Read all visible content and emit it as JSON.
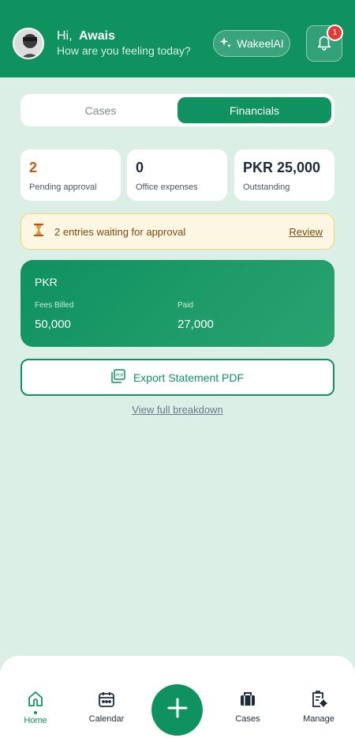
{
  "header": {
    "greeting": "Hi,",
    "user_name": "Awais",
    "subtitle": "How are you feeling today?",
    "ai_button_label": "WakeelAI",
    "notification_count": "1",
    "colors": {
      "brand": "#0f9160",
      "badge": "#e53935"
    }
  },
  "tabs": [
    {
      "label": "Cases",
      "active": false
    },
    {
      "label": "Financials",
      "active": true
    }
  ],
  "stats": [
    {
      "value": "2",
      "label": "Pending approval",
      "color": "#c05a10"
    },
    {
      "value": "0",
      "label": "Office expenses"
    },
    {
      "value": "PKR 25,000",
      "label": "Outstanding"
    }
  ],
  "approval": {
    "icon": "hourglass-icon",
    "text": "2 entries waiting for approval",
    "link": "Review"
  },
  "summary": {
    "currency": "PKR",
    "fees_billed_label": "Fees Billed",
    "fees_billed_value": "50,000",
    "paid_label": "Paid",
    "paid_value": "27,000"
  },
  "export_button": {
    "label": "Export Statement PDF",
    "icon": "pdf-icon"
  },
  "breakdown_link": "View full breakdown",
  "bottom_nav": [
    {
      "label": "Home",
      "icon": "home-icon",
      "active": true
    },
    {
      "label": "Calendar",
      "icon": "calendar-icon",
      "active": false
    },
    {
      "label": "",
      "icon": "plus-icon",
      "active": false
    },
    {
      "label": "Cases",
      "icon": "briefcase-icon",
      "active": false
    },
    {
      "label": "Manage",
      "icon": "manage-icon",
      "active": false
    }
  ]
}
